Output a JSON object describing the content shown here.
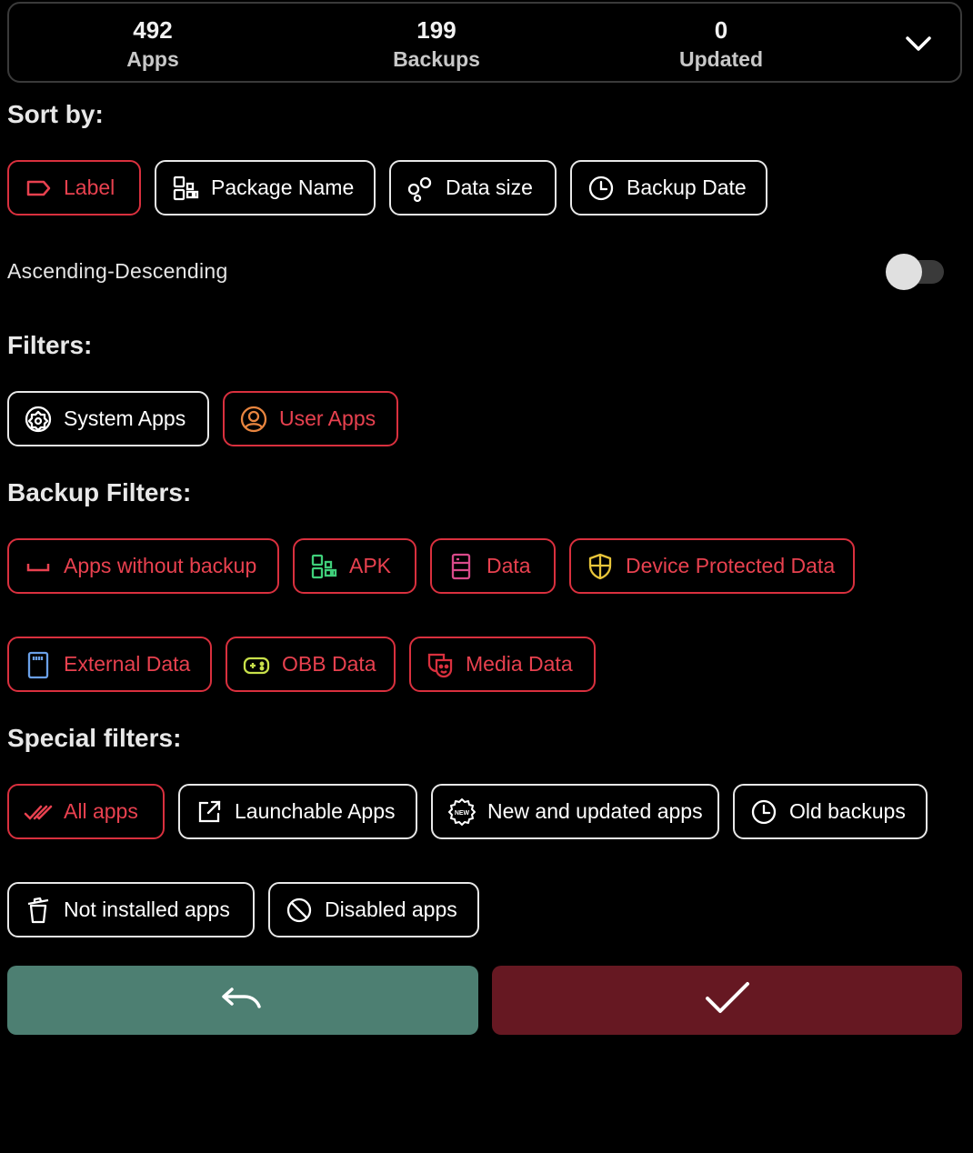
{
  "stats": {
    "apps": {
      "value": "492",
      "label": "Apps"
    },
    "backups": {
      "value": "199",
      "label": "Backups"
    },
    "updated": {
      "value": "0",
      "label": "Updated"
    }
  },
  "sort": {
    "title": "Sort by:",
    "options": {
      "label": "Label",
      "package_name": "Package Name",
      "data_size": "Data size",
      "backup_date": "Backup Date"
    },
    "selected": "Label",
    "order_label": "Ascending-Descending",
    "descending": false
  },
  "filters": {
    "title": "Filters:",
    "system_apps": "System Apps",
    "user_apps": "User Apps"
  },
  "backup_filters": {
    "title": "Backup Filters:",
    "without_backup": "Apps without backup",
    "apk": "APK",
    "data": "Data",
    "device_protected": "Device Protected Data",
    "external": "External Data",
    "obb": "OBB Data",
    "media": "Media Data"
  },
  "special_filters": {
    "title": "Special filters:",
    "all_apps": "All apps",
    "launchable": "Launchable Apps",
    "new_updated": "New and updated apps",
    "old_backups": "Old backups",
    "not_installed": "Not installed apps",
    "disabled": "Disabled apps",
    "selected": "All apps"
  },
  "icons": {
    "collapse": "chevron-down-icon",
    "reset": "undo-icon",
    "apply": "check-icon"
  },
  "colors": {
    "selected": "#d9303e",
    "reset_button": "#4d7f72",
    "apply_button": "#661822"
  }
}
